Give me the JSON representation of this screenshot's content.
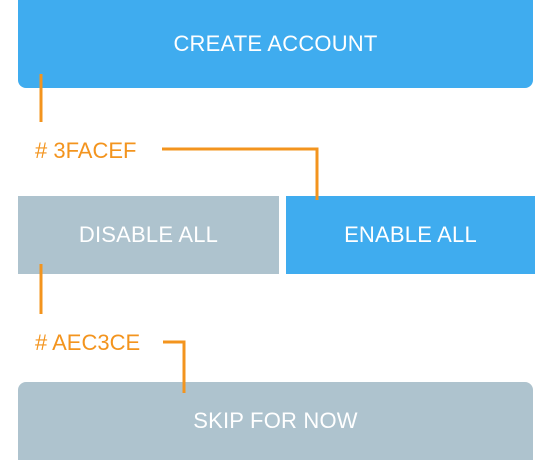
{
  "buttons": {
    "create_account": "CREATE ACCOUNT",
    "disable_all": "DISABLE ALL",
    "enable_all": "ENABLE ALL",
    "skip_for_now": "SKIP FOR NOW"
  },
  "annotations": {
    "blue_color_label": "# 3FACEF",
    "gray_color_label": "# AEC3CE"
  },
  "colors": {
    "primary": "#3FACEF",
    "secondary": "#AEC3CE",
    "annotation": "#F3941E",
    "button_text": "#FFFFFF"
  }
}
